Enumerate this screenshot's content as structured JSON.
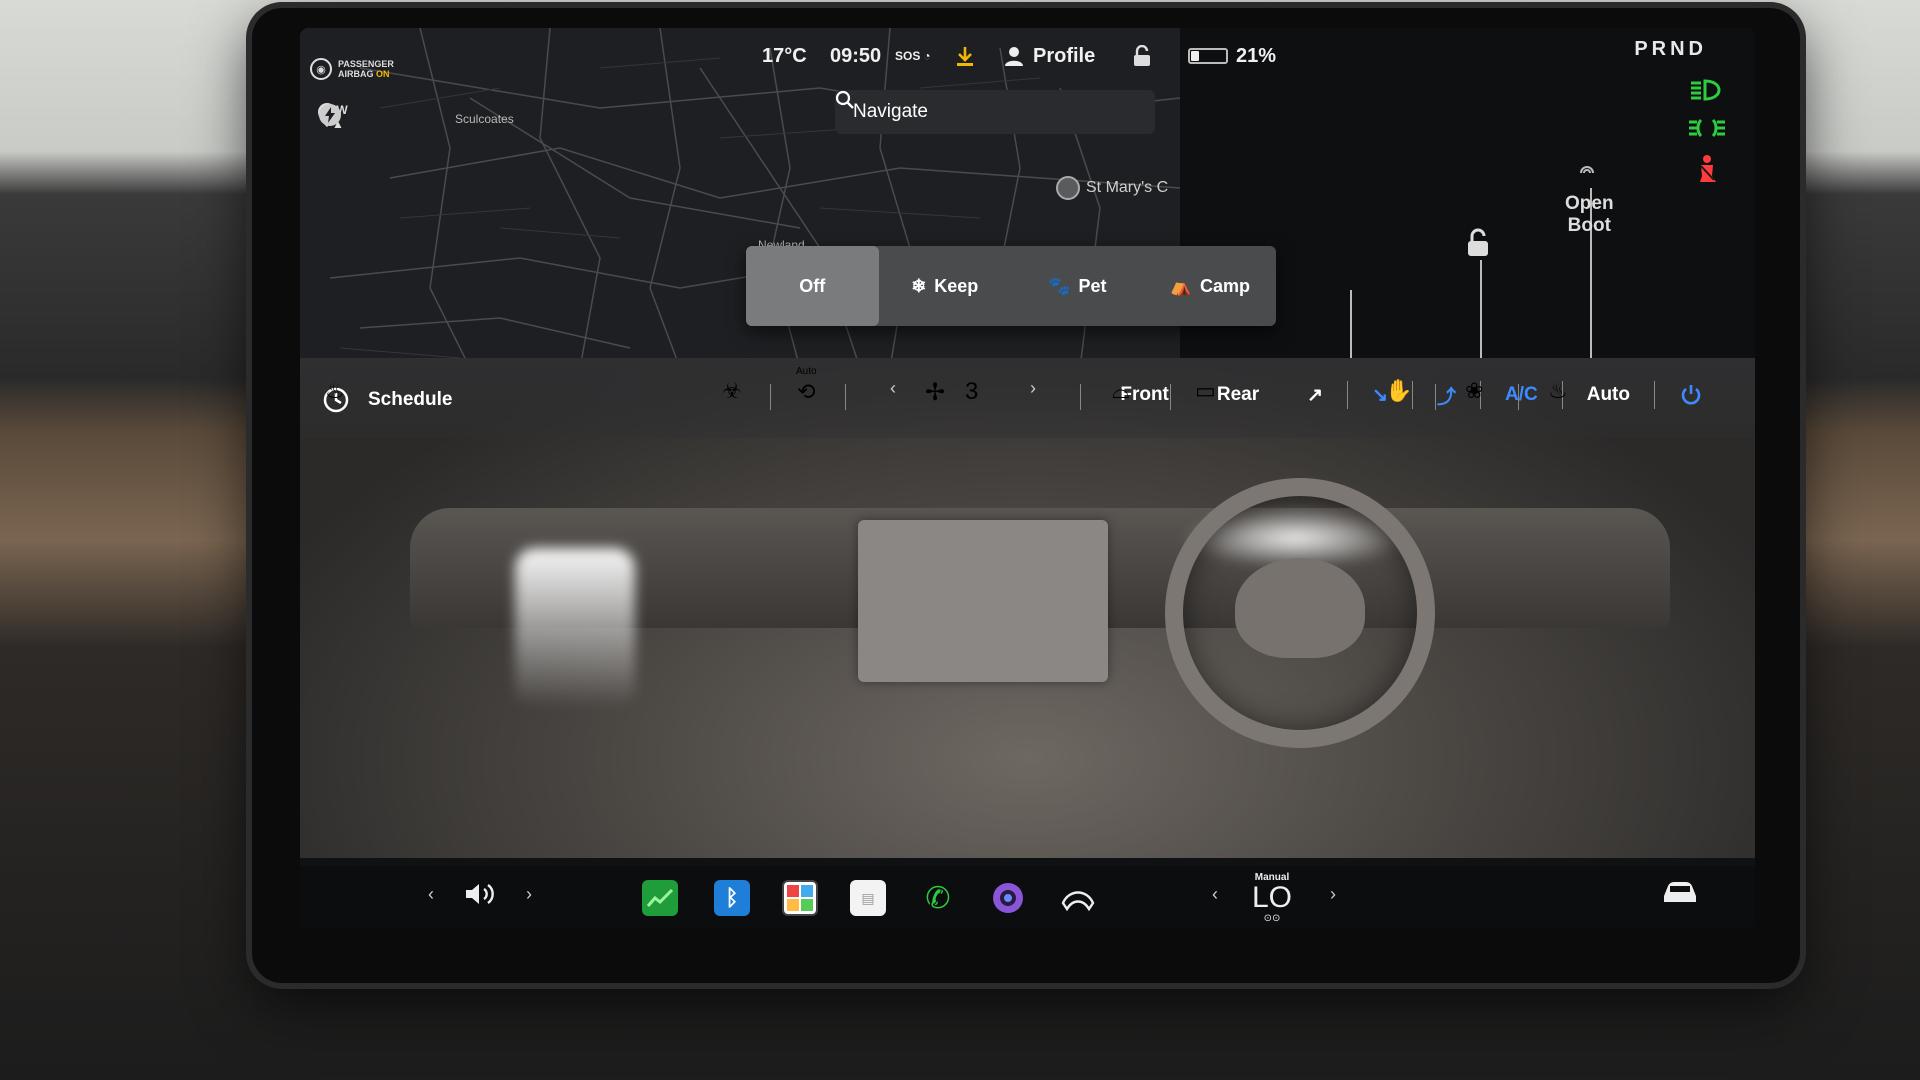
{
  "status_bar": {
    "airbag_line1": "PASSENGER",
    "airbag_line2_prefix": "AIRBAG",
    "airbag_state": "ON",
    "temperature": "17°C",
    "time": "09:50",
    "sos": "SOS",
    "profile_label": "Profile",
    "battery_percent": "21%",
    "battery_level": 0.21,
    "gear": "PRND"
  },
  "map": {
    "compass": "SW",
    "search_placeholder": "Navigate",
    "labels": {
      "sculcoates": "Sculcoates",
      "newland": "Newland",
      "st_marys": "St Mary's C"
    }
  },
  "side_panel": {
    "open_boot_line1": "Open",
    "open_boot_line2": "Boot"
  },
  "climate_modes": {
    "items": [
      {
        "label": "Off",
        "icon": "none"
      },
      {
        "label": "Keep",
        "icon": "keep-climate-icon"
      },
      {
        "label": "Pet",
        "icon": "paw-icon"
      },
      {
        "label": "Camp",
        "icon": "tent-icon"
      }
    ],
    "selected": "Off"
  },
  "climate": {
    "schedule_label": "Schedule",
    "front_label": "Front",
    "rear_label": "Rear",
    "ac_label": "A/C",
    "auto_label": "Auto",
    "fan_speed": "3",
    "recirc_label": "Auto",
    "accent_color": "#3d8bff"
  },
  "taskbar": {
    "drive_mode_label": "Manual",
    "passenger_temp": "LO",
    "apps": [
      "energy-app-icon",
      "bluetooth-icon",
      "toybox-icon",
      "notes-icon",
      "phone-icon",
      "camera-icon",
      "wiper-icon"
    ]
  }
}
